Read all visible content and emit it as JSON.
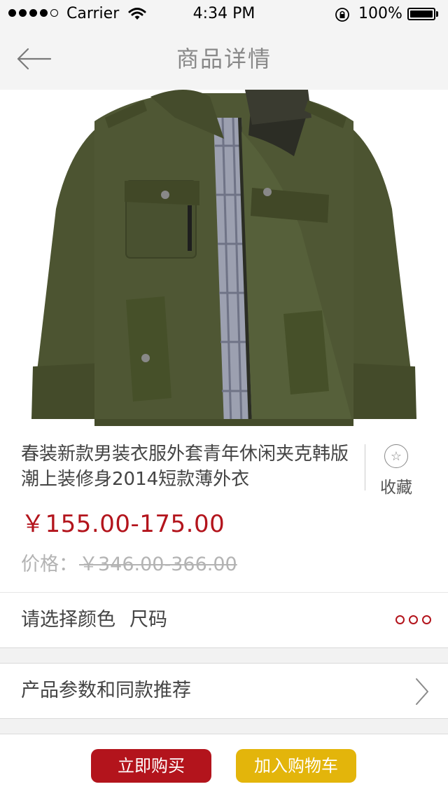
{
  "status_bar": {
    "carrier": "Carrier",
    "time": "4:34 PM",
    "battery": "100%",
    "signal_bars_filled": 4,
    "signal_bars_total": 5
  },
  "nav": {
    "title": "商品详情",
    "back_icon": "arrow-left-icon"
  },
  "product": {
    "image_icon": "olive-green-jacket-photo",
    "title": "春装新款男装衣服外套青年休闲夹克韩版潮上装修身2014短款薄外衣",
    "price": "￥155.00-175.00",
    "original_price_label": "价格：",
    "original_price": "￥346.00-366.00",
    "favorite_label": "收藏",
    "favorite_icon": "star-circle-icon"
  },
  "options_row": {
    "label_color": "请选择颜色",
    "label_size": "尺码",
    "icon": "more-dots-icon"
  },
  "params_row": {
    "label": "产品参数和同款推荐",
    "icon": "chevron-right-icon"
  },
  "actions": {
    "buy_now": "立即购买",
    "add_to_cart": "加入购物车"
  },
  "colors": {
    "price_red": "#b3141c",
    "buy_button": "#b3141c",
    "cart_button": "#e3b50b",
    "nav_title": "#888888"
  }
}
